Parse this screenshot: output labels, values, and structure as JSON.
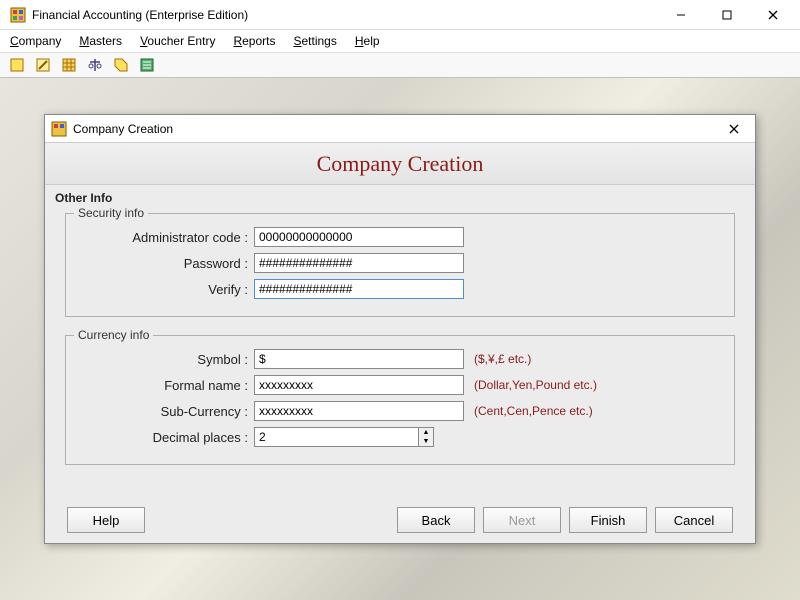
{
  "app": {
    "title": "Financial Accounting (Enterprise Edition)"
  },
  "menu": {
    "company": "Company",
    "masters": "Masters",
    "voucher": "Voucher Entry",
    "reports": "Reports",
    "settings": "Settings",
    "help": "Help"
  },
  "dialog": {
    "title": "Company Creation",
    "banner": "Company Creation",
    "section": "Other Info",
    "security": {
      "legend": "Security info",
      "admin_label": "Administrator code :",
      "admin_value": "00000000000000",
      "password_label": "Password :",
      "password_value": "##############",
      "verify_label": "Verify :",
      "verify_value": "##############"
    },
    "currency": {
      "legend": "Currency info",
      "symbol_label": "Symbol :",
      "symbol_value": "$",
      "symbol_hint": "($,¥,£ etc.)",
      "formal_label": "Formal name :",
      "formal_value": "xxxxxxxxx",
      "formal_hint": "(Dollar,Yen,Pound etc.)",
      "sub_label": "Sub-Currency :",
      "sub_value": "xxxxxxxxx",
      "sub_hint": "(Cent,Cen,Pence etc.)",
      "decimal_label": "Decimal places :",
      "decimal_value": "2"
    },
    "buttons": {
      "help": "Help",
      "back": "Back",
      "next": "Next",
      "finish": "Finish",
      "cancel": "Cancel"
    }
  }
}
